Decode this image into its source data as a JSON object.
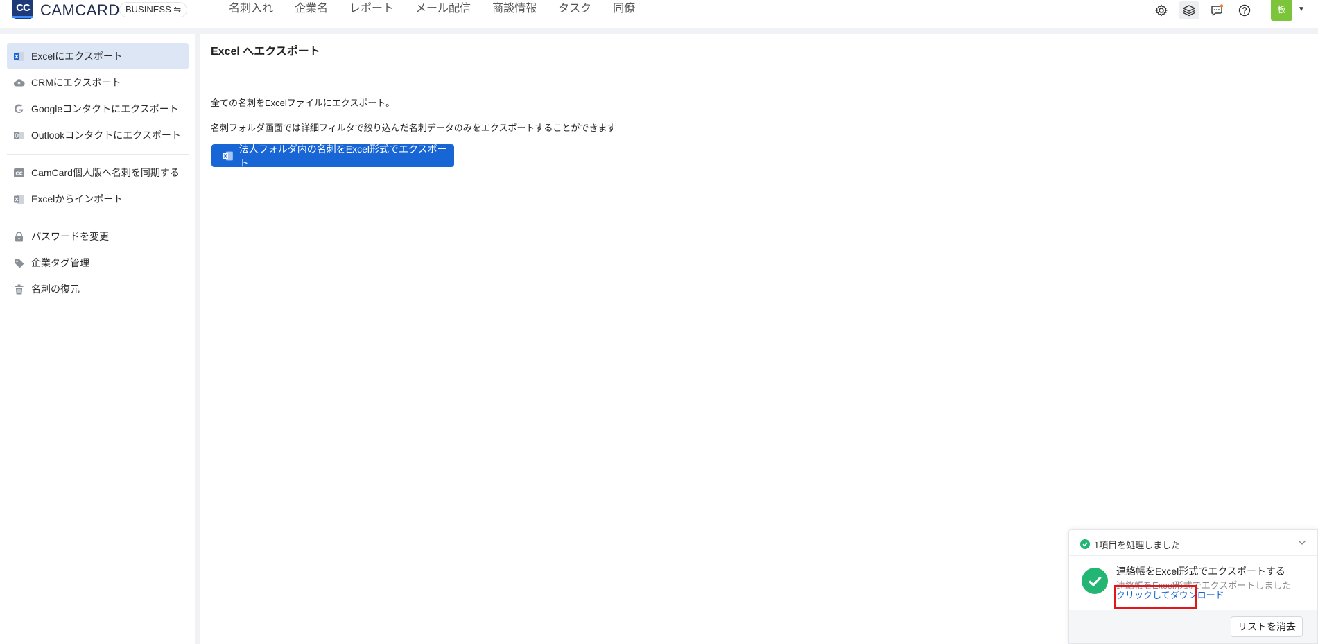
{
  "header": {
    "logo_text": "CC",
    "brand": "CAMCARD",
    "edition": "BUSINESS ⇋",
    "nav": [
      "名刺入れ",
      "企業名",
      "レポート",
      "メール配信",
      "商談情報",
      "タスク",
      "同僚"
    ],
    "icons": [
      "settings-icon",
      "layers-icon",
      "chat-icon",
      "help-icon"
    ],
    "avatar_text": "板",
    "avatar_color": "#7cc53a"
  },
  "sidebar": {
    "items": [
      {
        "label": "Excelにエクスポート",
        "icon": "excel-icon",
        "active": true
      },
      {
        "label": "CRMにエクスポート",
        "icon": "cloud-upload-icon"
      },
      {
        "label": "Googleコンタクトにエクスポート",
        "icon": "google-icon"
      },
      {
        "label": "Outlookコンタクトにエクスポート",
        "icon": "outlook-icon"
      },
      {
        "label": "CamCard個人版へ名刺を同期する",
        "icon": "camcard-icon"
      },
      {
        "label": "Excelからインポート",
        "icon": "excel-import-icon"
      },
      {
        "label": "パスワードを変更",
        "icon": "lock-icon"
      },
      {
        "label": "企業タグ管理",
        "icon": "tag-icon"
      },
      {
        "label": "名刺の復元",
        "icon": "trash-icon"
      }
    ]
  },
  "main": {
    "title": "Excel へエクスポート",
    "line1": "全ての名刺をExcelファイルにエクスポート。",
    "line2": "名刺フォルダ画面では詳細フィルタで絞り込んだ名刺データのみをエクスポートすることができます",
    "export_button": "法人フォルダ内の名刺をExcel形式でエクスポート"
  },
  "notification": {
    "header": "1項目を処理しました",
    "title": "連絡帳をExcel形式でエクスポートする",
    "subtitle": "連絡帳をExcel形式でエクスポートしました",
    "link": "クリックしてダウンロード",
    "clear_button": "リストを消去"
  },
  "colors": {
    "accent": "#1866d6",
    "success": "#22b573",
    "sidebar_active": "#dce6f5",
    "highlight": "#e3151a"
  }
}
